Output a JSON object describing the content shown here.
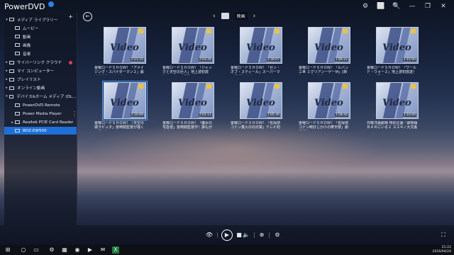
{
  "app": {
    "title": "PowerDVD"
  },
  "titlebar": {
    "icons": [
      "⚙",
      "⬜",
      "🔍",
      "—",
      "❐",
      "✕"
    ]
  },
  "sidebar": {
    "items": [
      {
        "label": "メディア ライブラリー",
        "level": 0,
        "arrow": "▾"
      },
      {
        "label": "ムービー",
        "level": 1
      },
      {
        "label": "動画",
        "level": 1
      },
      {
        "label": "画像",
        "level": 1
      },
      {
        "label": "音楽",
        "level": 1
      },
      {
        "label": "サイバーリンク クラウド",
        "level": 0,
        "arrow": "▸"
      },
      {
        "label": "マイ コンピューター",
        "level": 0,
        "arrow": "▸"
      },
      {
        "label": "プレイリスト",
        "level": 0,
        "arrow": "▸"
      },
      {
        "label": "オンライン動画",
        "level": 0,
        "arrow": "▸"
      },
      {
        "label": "デバイス&ホーム メディア (DLNA)",
        "level": 0,
        "arrow": "▾"
      },
      {
        "label": "PowerDVD Remote",
        "level": 1
      },
      {
        "label": "Power Media Player",
        "level": 1
      },
      {
        "label": "Realtek PCIE Card Reader",
        "level": 1,
        "arrow": "▸"
      },
      {
        "label": "BDZ-EW500",
        "level": 1,
        "selected": true
      }
    ],
    "add_label": "+"
  },
  "nav": {
    "back": "←",
    "prev": "‹",
    "next": "›",
    "folder_name": "映画"
  },
  "tiles": [
    {
      "caption": "金曜ロードＳＨＯＷ！「アメイジング・スパイダーマン２」最速地上波スパイダーマン…",
      "time": "2:21:25",
      "selected": false
    },
    {
      "caption": "金曜ロードＳＨＯＷ！「ジャックと天空の巨人」地上波初放送！ワクワク冒険…",
      "time": "2:03:26",
      "selected": false
    },
    {
      "caption": "金曜ロードＳＨＯＷ！「ゼン・オブ・スティール」スーパーマン最新作 地上…",
      "time": "2:30:07",
      "selected": false
    },
    {
      "caption": "金曜ロードＳＨＯＷ！「ルパン三世 ＩクリアンーゲーＭ」[新作テレビ初放送]…",
      "time": "1:48:22",
      "selected": false
    },
    {
      "caption": "金曜ロードＳＨＯＷ！「ワールド・ウォーＺ」地上波初放送！ブラピ最大ス…",
      "time": "2:15:00",
      "selected": false
    },
    {
      "caption": "金曜ロードＳＨＯＷ！「天空の城ラピュタ」宮崎駿監督が描く不朽の名…",
      "time": "2:10:09",
      "selected": true
    },
    {
      "caption": "金曜ロードＳＨＯＷ！「魔女の宅急便」宮崎駿監督作！誰もが共感す…",
      "time": "2:01:11",
      "selected": false
    },
    {
      "caption": "金曜ロードＳＨＯＷ！「名探偵コナン業火の向日葵」テレビ初放送[ロロ",
      "time": "2:05:30",
      "selected": false
    },
    {
      "caption": "金曜ロードＳＨＯＷ！「名探偵コナン時計じかけの摩天楼」劇場版第…",
      "time": "1:58:44",
      "selected": false
    },
    {
      "caption": "日曜洋画劇場 特別企画『劇場版ＢＡＲにいる２ ススキノ大交差点』[ロ",
      "time": "2:10:00",
      "selected": false
    }
  ],
  "controls": {
    "eye": "👁",
    "play": "▶",
    "stop": "■",
    "volume": "🔈",
    "zoom": "⊕",
    "settings": "⚙",
    "fullscreen": "⛶"
  },
  "taskbar": {
    "icons": [
      "⊞",
      "○",
      "▭",
      "⚙",
      "▦",
      "◉",
      "▶",
      "✉",
      "X"
    ],
    "time": "21:22",
    "date": "2016/04/24"
  }
}
